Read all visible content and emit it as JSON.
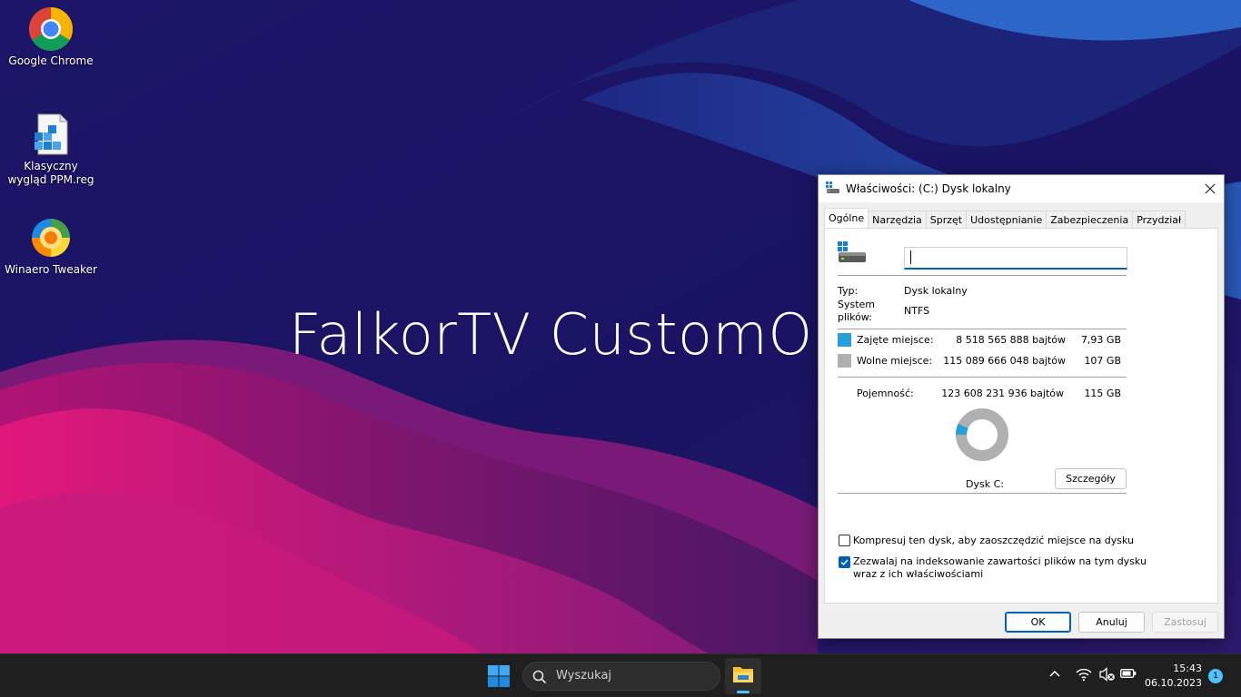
{
  "desktop": {
    "brand_text": "FalkorTV CustomOS",
    "icons": [
      {
        "label": "Google Chrome",
        "icon": "chrome-icon"
      },
      {
        "label": "Klasyczny wygląd PPM.reg",
        "icon": "registry-file-icon"
      },
      {
        "label": "Winaero Tweaker",
        "icon": "winaero-tweaker-icon"
      }
    ]
  },
  "dialog": {
    "title": "Właściwości: (C:) Dysk lokalny",
    "tabs": [
      "Ogólne",
      "Narzędzia",
      "Sprzęt",
      "Udostępnianie",
      "Zabezpieczenia",
      "Przydział"
    ],
    "active_tab": "Ogólne",
    "name_value": "",
    "type_label": "Typ:",
    "type_value": "Dysk lokalny",
    "fs_label_line1": "System",
    "fs_label_line2": "plików:",
    "fs_value": "NTFS",
    "used_label": "Zajęte miejsce:",
    "used_bytes": "8 518 565 888 bajtów",
    "used_gb": "7,93 GB",
    "free_label": "Wolne miejsce:",
    "free_bytes": "115 089 666 048 bajtów",
    "free_gb": "107 GB",
    "capacity_label": "Pojemność:",
    "capacity_bytes": "123 608 231 936 bajtów",
    "capacity_gb": "115 GB",
    "drive_label": "Dysk C:",
    "details_button": "Szczegóły",
    "compress_label": "Kompresuj ten dysk, aby zaoszczędzić miejsce na dysku",
    "compress_checked": false,
    "index_label_line1": "Zezwalaj na indeksowanie zawartości plików na tym dysku",
    "index_label_line2": "wraz z ich właściwościami",
    "index_checked": true,
    "ok_button": "OK",
    "cancel_button": "Anuluj",
    "apply_button": "Zastosuj",
    "used_fraction": 0.069,
    "used_color": "#26a0da",
    "free_color": "#b0b0b0"
  },
  "taskbar": {
    "search_placeholder": "Wyszukaj",
    "time": "15:43",
    "date": "06.10.2023",
    "notification_count": "1"
  },
  "colors": {
    "accent": "#005fb8",
    "taskbar_bg": "#1f1f1f"
  }
}
